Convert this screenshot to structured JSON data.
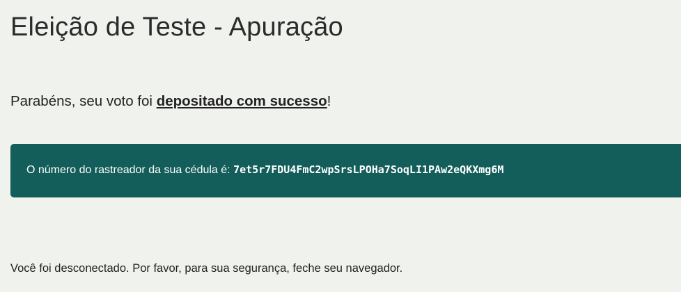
{
  "page": {
    "title": "Eleição de Teste - Apuração",
    "success_prefix": "Parabéns, seu voto foi ",
    "success_link": "depositado com sucesso",
    "success_suffix": "!",
    "tracker_label": "O número do rastreador da sua cédula é: ",
    "tracker_code": "7et5r7FDU4FmC2wpSrsLPOHa7SoqLI1PAw2eQKXmg6M",
    "logout_message": "Você foi desconectado. Por favor, para sua segurança, feche seu navegador."
  },
  "colors": {
    "background": "#f0f2ee",
    "tracker_box": "#135e5a",
    "text": "#222222"
  }
}
